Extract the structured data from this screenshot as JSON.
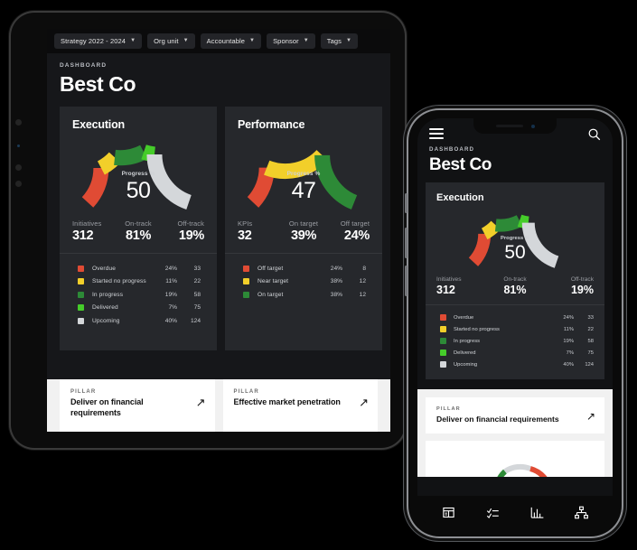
{
  "filters": [
    {
      "label": "Strategy 2022 - 2024"
    },
    {
      "label": "Org unit"
    },
    {
      "label": "Accountable"
    },
    {
      "label": "Sponsor"
    },
    {
      "label": "Tags"
    }
  ],
  "header": {
    "eyebrow": "DASHBOARD",
    "title": "Best Co"
  },
  "chart_data": [
    {
      "type": "pie",
      "title": "Execution",
      "center_label": "Progress %",
      "center_value": "50",
      "categories": [
        "Overdue",
        "Started no progress",
        "In progress",
        "Delivered",
        "Upcoming"
      ],
      "values": [
        24,
        11,
        19,
        7,
        40
      ],
      "counts": [
        33,
        22,
        58,
        75,
        124
      ],
      "percent_labels": [
        "24%",
        "11%",
        "19%",
        "7%",
        "40%"
      ],
      "count_labels": [
        "33",
        "22",
        "58",
        "75",
        "124"
      ],
      "colors": [
        "#e04b34",
        "#f2cf2a",
        "#2d8a37",
        "#45cc2a",
        "#d4d7da"
      ],
      "legend": "right",
      "stats": [
        {
          "key": "Initiatives",
          "value": "312"
        },
        {
          "key": "On-track",
          "value": "81%"
        },
        {
          "key": "Off-track",
          "value": "19%"
        }
      ]
    },
    {
      "type": "pie",
      "title": "Performance",
      "center_label": "Progress %",
      "center_value": "47",
      "categories": [
        "Off target",
        "Near target",
        "On target"
      ],
      "values": [
        24,
        38,
        38
      ],
      "counts": [
        8,
        12,
        12
      ],
      "percent_labels": [
        "24%",
        "38%",
        "38%"
      ],
      "count_labels": [
        "8",
        "12",
        "12"
      ],
      "colors": [
        "#e04b34",
        "#f2cf2a",
        "#2d8a37"
      ],
      "legend": "right",
      "stats": [
        {
          "key": "KPIs",
          "value": "32"
        },
        {
          "key": "On target",
          "value": "39%"
        },
        {
          "key": "Off target",
          "value": "24%"
        }
      ]
    }
  ],
  "pillars": [
    {
      "eyebrow": "PILLAR",
      "title": "Deliver on financial requirements",
      "icon": "arrow-up-right-icon"
    },
    {
      "eyebrow": "PILLAR",
      "title": "Effective market penetration",
      "icon": "arrow-up-right-icon"
    }
  ],
  "phone": {
    "menu_icon": "hamburger-menu-icon",
    "search_icon": "search-icon",
    "eyebrow": "DASHBOARD",
    "title": "Best Co",
    "pillar": {
      "eyebrow": "PILLAR",
      "title": "Deliver on financial requirements"
    },
    "tabs": [
      {
        "name": "tab-board",
        "icon": "board-icon"
      },
      {
        "name": "tab-tasks",
        "icon": "checklist-icon"
      },
      {
        "name": "tab-reports",
        "icon": "bar-chart-icon"
      },
      {
        "name": "tab-hierarchy",
        "icon": "org-tree-icon"
      }
    ]
  }
}
